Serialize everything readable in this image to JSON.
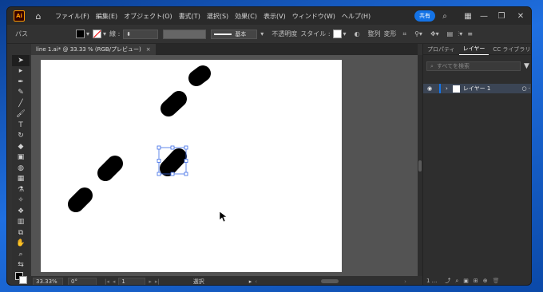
{
  "app": {
    "logo": "Ai",
    "share_label": "共有"
  },
  "menu": [
    "ファイル(F)",
    "編集(E)",
    "オブジェクト(O)",
    "書式(T)",
    "選択(S)",
    "効果(C)",
    "表示(V)",
    "ウィンドウ(W)",
    "ヘルプ(H)"
  ],
  "control": {
    "object_type": "パス",
    "stroke_label": "線 :",
    "brush_label": "基本",
    "opacity_label": "不透明度",
    "style_label": "スタイル :",
    "align_label": "整列",
    "transform_label": "変形"
  },
  "document_tab": {
    "title": "line 1.ai* @ 33.33 % (RGB/プレビュー)",
    "close": "×"
  },
  "status": {
    "zoom": "33.33%",
    "rotation": "0°",
    "artboard": "1",
    "tool": "選択"
  },
  "panel": {
    "tabs": [
      "プロパティ",
      "レイヤー",
      "CC ライブラリ"
    ],
    "active_tab": "レイヤー",
    "search_placeholder": "すべてを検索",
    "layer_name": "レイヤー 1",
    "layer_count": "1 ..."
  },
  "colors": {
    "selection": "#3c6be6",
    "accent": "#1473e6"
  }
}
